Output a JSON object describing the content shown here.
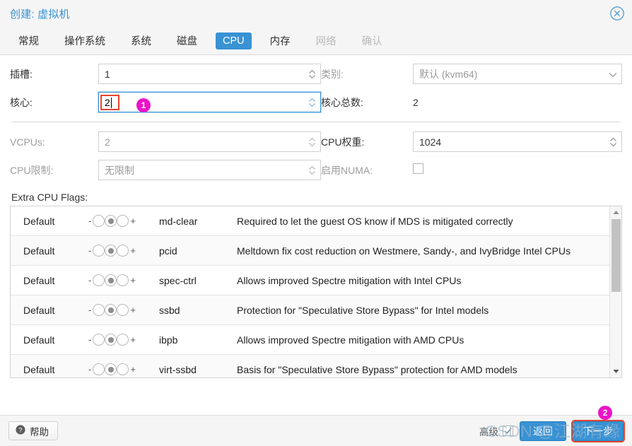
{
  "window": {
    "title": "创建: 虚拟机",
    "close_icon": "close-circle-icon",
    "accent": "#3892d4",
    "highlight_color": "#e8452c",
    "badge_color": "#ec13c8"
  },
  "tabs": [
    {
      "label": "常规",
      "state": "normal"
    },
    {
      "label": "操作系统",
      "state": "normal"
    },
    {
      "label": "系统",
      "state": "normal"
    },
    {
      "label": "磁盘",
      "state": "normal"
    },
    {
      "label": "CPU",
      "state": "active"
    },
    {
      "label": "内存",
      "state": "normal"
    },
    {
      "label": "网络",
      "state": "disabled"
    },
    {
      "label": "确认",
      "state": "disabled"
    }
  ],
  "form": {
    "sockets": {
      "label": "插槽:",
      "value": "1",
      "type": "spinner"
    },
    "cores": {
      "label": "核心:",
      "value": "2",
      "type": "spinner",
      "focused": true
    },
    "type": {
      "label": "类别:",
      "value": "默认 (kvm64)",
      "type": "combobox",
      "disabled": true
    },
    "total_cores": {
      "label": "核心总数:",
      "value": "2",
      "type": "text"
    },
    "vcpus": {
      "label": "VCPUs:",
      "value": "2",
      "type": "spinner",
      "disabled": true
    },
    "cpu_units": {
      "label": "CPU权重:",
      "value": "1024",
      "type": "spinner"
    },
    "cpu_limit": {
      "label": "CPU限制:",
      "value": "无限制",
      "type": "spinner",
      "disabled": true
    },
    "enable_numa": {
      "label": "启用NUMA:",
      "checked": false,
      "type": "checkbox",
      "disabled": true
    }
  },
  "extra_cpu_flags": {
    "label": "Extra CPU Flags:",
    "toggle_minus": "-",
    "toggle_plus": "+",
    "rows": [
      {
        "state": "Default",
        "toggle": "default",
        "flag": "md-clear",
        "description": "Required to let the guest OS know if MDS is mitigated correctly"
      },
      {
        "state": "Default",
        "toggle": "default",
        "flag": "pcid",
        "description": "Meltdown fix cost reduction on Westmere, Sandy-, and IvyBridge Intel CPUs"
      },
      {
        "state": "Default",
        "toggle": "default",
        "flag": "spec-ctrl",
        "description": "Allows improved Spectre mitigation with Intel CPUs"
      },
      {
        "state": "Default",
        "toggle": "default",
        "flag": "ssbd",
        "description": "Protection for \"Speculative Store Bypass\" for Intel models"
      },
      {
        "state": "Default",
        "toggle": "default",
        "flag": "ibpb",
        "description": "Allows improved Spectre mitigation with AMD CPUs"
      },
      {
        "state": "Default",
        "toggle": "default",
        "flag": "virt-ssbd",
        "description": "Basis for \"Speculative Store Bypass\" protection for AMD models"
      }
    ],
    "scrollbar": {
      "up_icon": "triangle-up-icon",
      "down_icon": "triangle-down-icon"
    }
  },
  "footer": {
    "help_label": "帮助",
    "help_icon": "question-circle-icon",
    "advanced_label": "高级",
    "advanced_checked": true,
    "back_label": "返回",
    "next_label": "下一步"
  },
  "annotations": {
    "badge_1": "1",
    "badge_2": "2"
  },
  "watermark": {
    "text": "CSDN @江湖有缘"
  }
}
